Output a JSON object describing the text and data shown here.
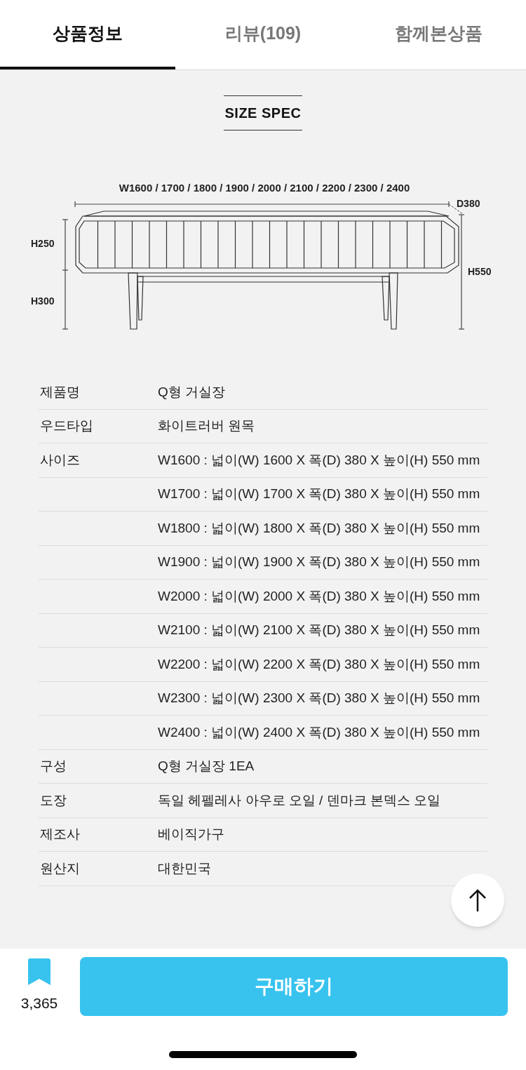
{
  "tabs": [
    {
      "label": "상품정보",
      "selected": true
    },
    {
      "label": "리뷰(109)",
      "selected": false
    },
    {
      "label": "함께본상품",
      "selected": false
    }
  ],
  "spec_title": "SIZE SPEC",
  "diagram": {
    "width_label": "W1600 / 1700 / 1800 / 1900 / 2000 / 2100 / 2200 / 2300 / 2400",
    "depth_label": "D380",
    "upper_height_label": "H250",
    "lower_height_label": "H300",
    "total_height_label": "H550"
  },
  "specs": [
    {
      "label": "제품명",
      "value": "Q형 거실장"
    },
    {
      "label": "우드타입",
      "value": "화이트러버 원목"
    },
    {
      "label": "사이즈",
      "value": "W1600 : 넓이(W) 1600 X 폭(D) 380 X 높이(H) 550 mm"
    },
    {
      "value": "W1700 : 넓이(W) 1700 X 폭(D) 380 X 높이(H) 550 mm"
    },
    {
      "value": "W1800 : 넓이(W) 1800 X 폭(D) 380 X 높이(H) 550 mm"
    },
    {
      "value": "W1900 : 넓이(W) 1900 X 폭(D) 380 X 높이(H) 550 mm"
    },
    {
      "value": "W2000 : 넓이(W) 2000 X 폭(D) 380 X 높이(H) 550 mm"
    },
    {
      "value": "W2100 : 넓이(W) 2100 X 폭(D) 380 X 높이(H) 550 mm"
    },
    {
      "value": "W2200 : 넓이(W) 2200 X 폭(D) 380 X 높이(H) 550 mm"
    },
    {
      "value": "W2300 : 넓이(W) 2300 X 폭(D) 380 X 높이(H) 550 mm"
    },
    {
      "value": "W2400 : 넓이(W) 2400 X 폭(D) 380 X 높이(H) 550 mm"
    },
    {
      "label": "구성",
      "value": "Q형 거실장 1EA"
    },
    {
      "label": "도장",
      "value": "독일 헤펠레사 아우로 오일 / 덴마크 본덱스 오일"
    },
    {
      "label": "제조사",
      "value": "베이직가구"
    },
    {
      "label": "원산지",
      "value": "대한민국"
    }
  ],
  "bookmark_count": "3,365",
  "buy_button": "구매하기"
}
